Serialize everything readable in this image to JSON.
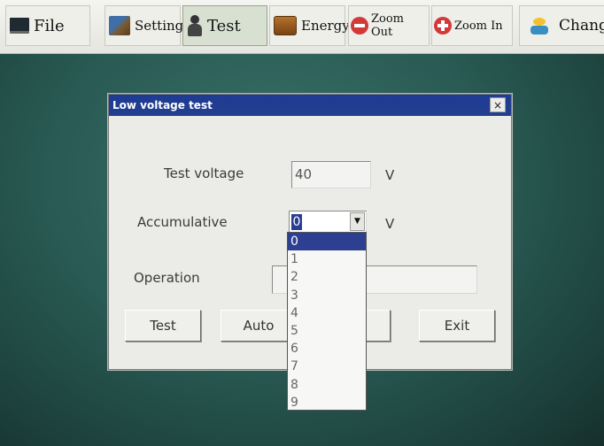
{
  "toolbar": {
    "file": "File",
    "setting": "Setting",
    "test": "Test",
    "energy": "Energy",
    "zoom_out": "Zoom Out",
    "zoom_in": "Zoom In",
    "change": "Chang"
  },
  "dialog": {
    "title": "Low voltage test",
    "close": "×",
    "test_voltage_label": "Test voltage",
    "test_voltage_value": "40",
    "test_voltage_unit": "V",
    "accumulative_label": "Accumulative",
    "accumulative_value": "0",
    "accumulative_unit": "V",
    "operation_label": "Operation",
    "operation_value": "",
    "buttons": {
      "test": "Test",
      "auto": "Auto",
      "exit": "Exit"
    }
  },
  "dropdown": {
    "options": [
      "0",
      "1",
      "2",
      "3",
      "4",
      "5",
      "6",
      "7",
      "8",
      "9"
    ],
    "selected": "0"
  },
  "colors": {
    "titlebar": "#1e3b93",
    "selection": "#2c3f91",
    "desktop": "#2a5c55"
  }
}
